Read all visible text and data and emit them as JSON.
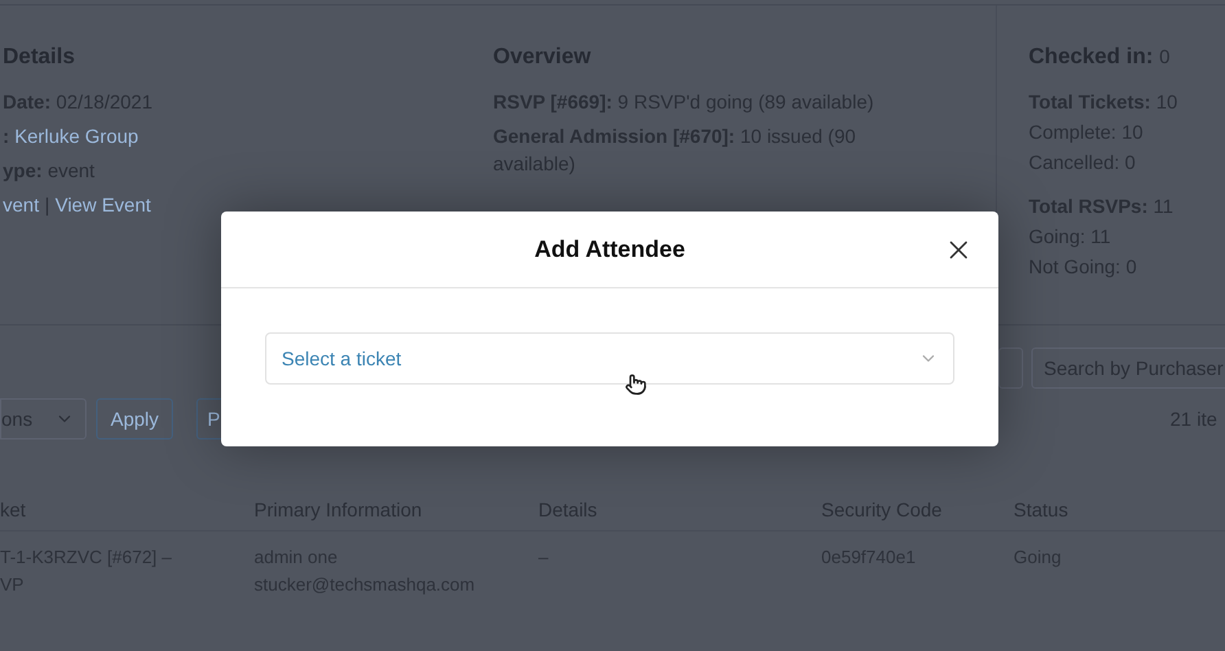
{
  "event_details": {
    "heading": "Details",
    "lines": [
      {
        "label": "Date:",
        "value": "02/18/2021",
        "kind": "text"
      },
      {
        "label": ":",
        "value": "Kerluke Group",
        "kind": "link"
      },
      {
        "label": "ype:",
        "value": "event",
        "kind": "text"
      }
    ],
    "links": [
      "vent",
      "View Event"
    ],
    "separator": "|"
  },
  "overview": {
    "heading": "Overview",
    "lines": [
      {
        "label": "RSVP [#669]:",
        "value": "9 RSVP'd going (89 available)"
      },
      {
        "label": "General Admission [#670]:",
        "value": "10 issued (90 available)"
      }
    ]
  },
  "stats": {
    "checked_in": {
      "label": "Checked in:",
      "value": "0"
    },
    "groups": [
      [
        {
          "label": "Total Tickets:",
          "value": "10",
          "kind": "total"
        },
        {
          "label": "Complete:",
          "value": "10",
          "kind": "sub"
        },
        {
          "label": "Cancelled:",
          "value": "0",
          "kind": "sub"
        }
      ],
      [
        {
          "label": "Total RSVPs:",
          "value": "11",
          "kind": "total"
        },
        {
          "label": "Going:",
          "value": "11",
          "kind": "sub"
        },
        {
          "label": "Not Going:",
          "value": "0",
          "kind": "sub"
        }
      ]
    ]
  },
  "toolbar": {
    "bulk_actions": "ons",
    "apply": "Apply",
    "partial_button": "P",
    "search": {
      "placeholder": "Search by Purchaser"
    },
    "count": "21 ite"
  },
  "table": {
    "columns": [
      "ket",
      "Primary Information",
      "Details",
      "Security Code",
      "Status"
    ],
    "rows": [
      {
        "cells": [
          [
            "T-1-K3RZVC [#672] –",
            "VP"
          ],
          [
            "admin one",
            "stucker@techsmashqa.com"
          ],
          [
            "–"
          ],
          [
            "0e59f740e1"
          ],
          [
            "Going"
          ]
        ]
      }
    ]
  },
  "modal": {
    "title": "Add Attendee",
    "select": {
      "placeholder": "Select a ticket"
    }
  }
}
